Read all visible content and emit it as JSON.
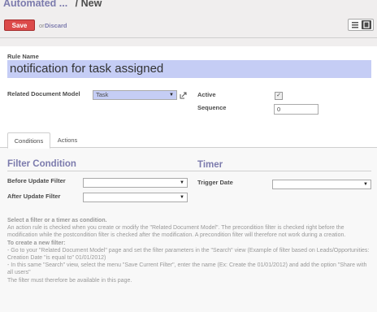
{
  "breadcrumb": {
    "parent": "Automated ...",
    "separator": "/",
    "current": "New"
  },
  "toolbar": {
    "save_label": "Save",
    "or_label": "or",
    "discard_label": "Discard"
  },
  "view_switcher": {
    "list_icon": "list-view-icon",
    "form_icon": "form-view-icon"
  },
  "form": {
    "rule_name_label": "Rule Name",
    "rule_name_value": "notification for task assigned",
    "model_label": "Related Document Model",
    "model_value": "Task",
    "active_label": "Active",
    "active_checked": true,
    "sequence_label": "Sequence",
    "sequence_value": "0"
  },
  "tabs": [
    {
      "label": "Conditions",
      "active": true
    },
    {
      "label": "Actions",
      "active": false
    }
  ],
  "conditions": {
    "filter_title": "Filter Condition",
    "timer_title": "Timer",
    "before_label": "Before Update Filter",
    "after_label": "After Update Filter",
    "trigger_label": "Trigger Date"
  },
  "help": {
    "line1": "Select a filter or a timer as condition.",
    "line2": "An action rule is checked when you create or modify the \"Related Document Model\". The precondition filter is checked right before the modification while the postcondition filter is checked after the modification. A precondition filter will therefore not work during a creation.",
    "line3": "To create a new filter:",
    "line4": "- Go to your \"Related Document Model\" page and set the filter parameters in the \"Search\" view (Example of filter based on Leads/Opportunities: Creation Date \"is equal to\" 01/01/2012)",
    "line5": "- In this same \"Search\" view, select the menu \"Save Current Filter\", enter the name (Ex: Create the 01/01/2012) and add the option \"Share with all users\"",
    "line6": "The filter must therefore be available in this page."
  },
  "colors": {
    "accent": "#7c7bad",
    "save": "#dc4a4a",
    "required_field": "#c5cdf5"
  }
}
